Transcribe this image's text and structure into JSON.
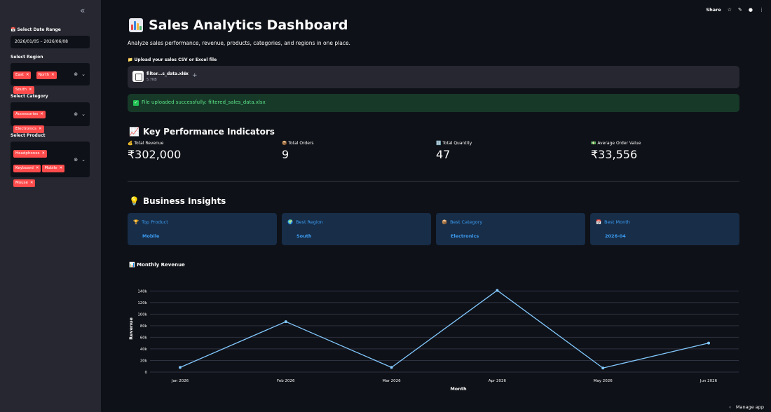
{
  "sidebar": {
    "collapse_icon": "«",
    "date_range": {
      "label": "Select Date Range",
      "value": "2026/01/05 – 2026/06/08"
    },
    "region": {
      "label": "Select Region",
      "chips": [
        "East",
        "North",
        "South"
      ]
    },
    "category": {
      "label": "Select Category",
      "chips": [
        "Accessories",
        "Electronics"
      ]
    },
    "product": {
      "label": "Select Product",
      "chips": [
        "Headphones",
        "Keyboard",
        "Mobile",
        "Mouse"
      ]
    }
  },
  "toolbar": {
    "share": "Share",
    "star_icon": "☆",
    "edit_icon": "✎",
    "github_icon": "●",
    "menu_icon": "⋮"
  },
  "header": {
    "title": "Sales Analytics Dashboard",
    "subtitle": "Analyze sales performance, revenue, products, categories, and regions in one place."
  },
  "upload": {
    "label": "📁 Upload your sales CSV or Excel file",
    "file_name": "filter...s_data.xlsx",
    "file_size": "5.7KB",
    "success": "File uploaded successfully: filtered_sales_data.xlsx"
  },
  "kpi": {
    "heading": "Key Performance Indicators",
    "items": [
      {
        "emoji": "💰",
        "label": "Total Revenue",
        "value": "₹302,000"
      },
      {
        "emoji": "📦",
        "label": "Total Orders",
        "value": "9"
      },
      {
        "emoji": "🔢",
        "label": "Total Quantity",
        "value": "47"
      },
      {
        "emoji": "💵",
        "label": "Average Order Value",
        "value": "₹33,556"
      }
    ]
  },
  "insights": {
    "heading": "Business Insights",
    "items": [
      {
        "emoji": "🏆",
        "label": "Top Product",
        "value": "Mobile"
      },
      {
        "emoji": "🌍",
        "label": "Best Region",
        "value": "South"
      },
      {
        "emoji": "📦",
        "label": "Best Category",
        "value": "Electronics"
      },
      {
        "emoji": "📅",
        "label": "Best Month",
        "value": "2026-04"
      }
    ]
  },
  "chart_title": "Monthly Revenue",
  "chart_data": {
    "type": "line",
    "x": [
      "Jan 2026",
      "Feb 2026",
      "Mar 2026",
      "Apr 2026",
      "May 2026",
      "Jun 2026"
    ],
    "series": [
      {
        "values": [
          8000,
          87000,
          8000,
          141000,
          7000,
          50000
        ]
      }
    ],
    "xlabel": "Month",
    "ylabel": "Revenue",
    "ylim": [
      0,
      150000
    ],
    "yticks": [
      0,
      20000,
      40000,
      60000,
      80000,
      100000,
      120000,
      140000
    ],
    "ytick_labels": [
      "0",
      "20k",
      "40k",
      "60k",
      "80k",
      "100k",
      "120k",
      "140k"
    ],
    "grid": true,
    "line_color": "#83c9ff"
  },
  "footer": {
    "manage": "Manage app"
  }
}
